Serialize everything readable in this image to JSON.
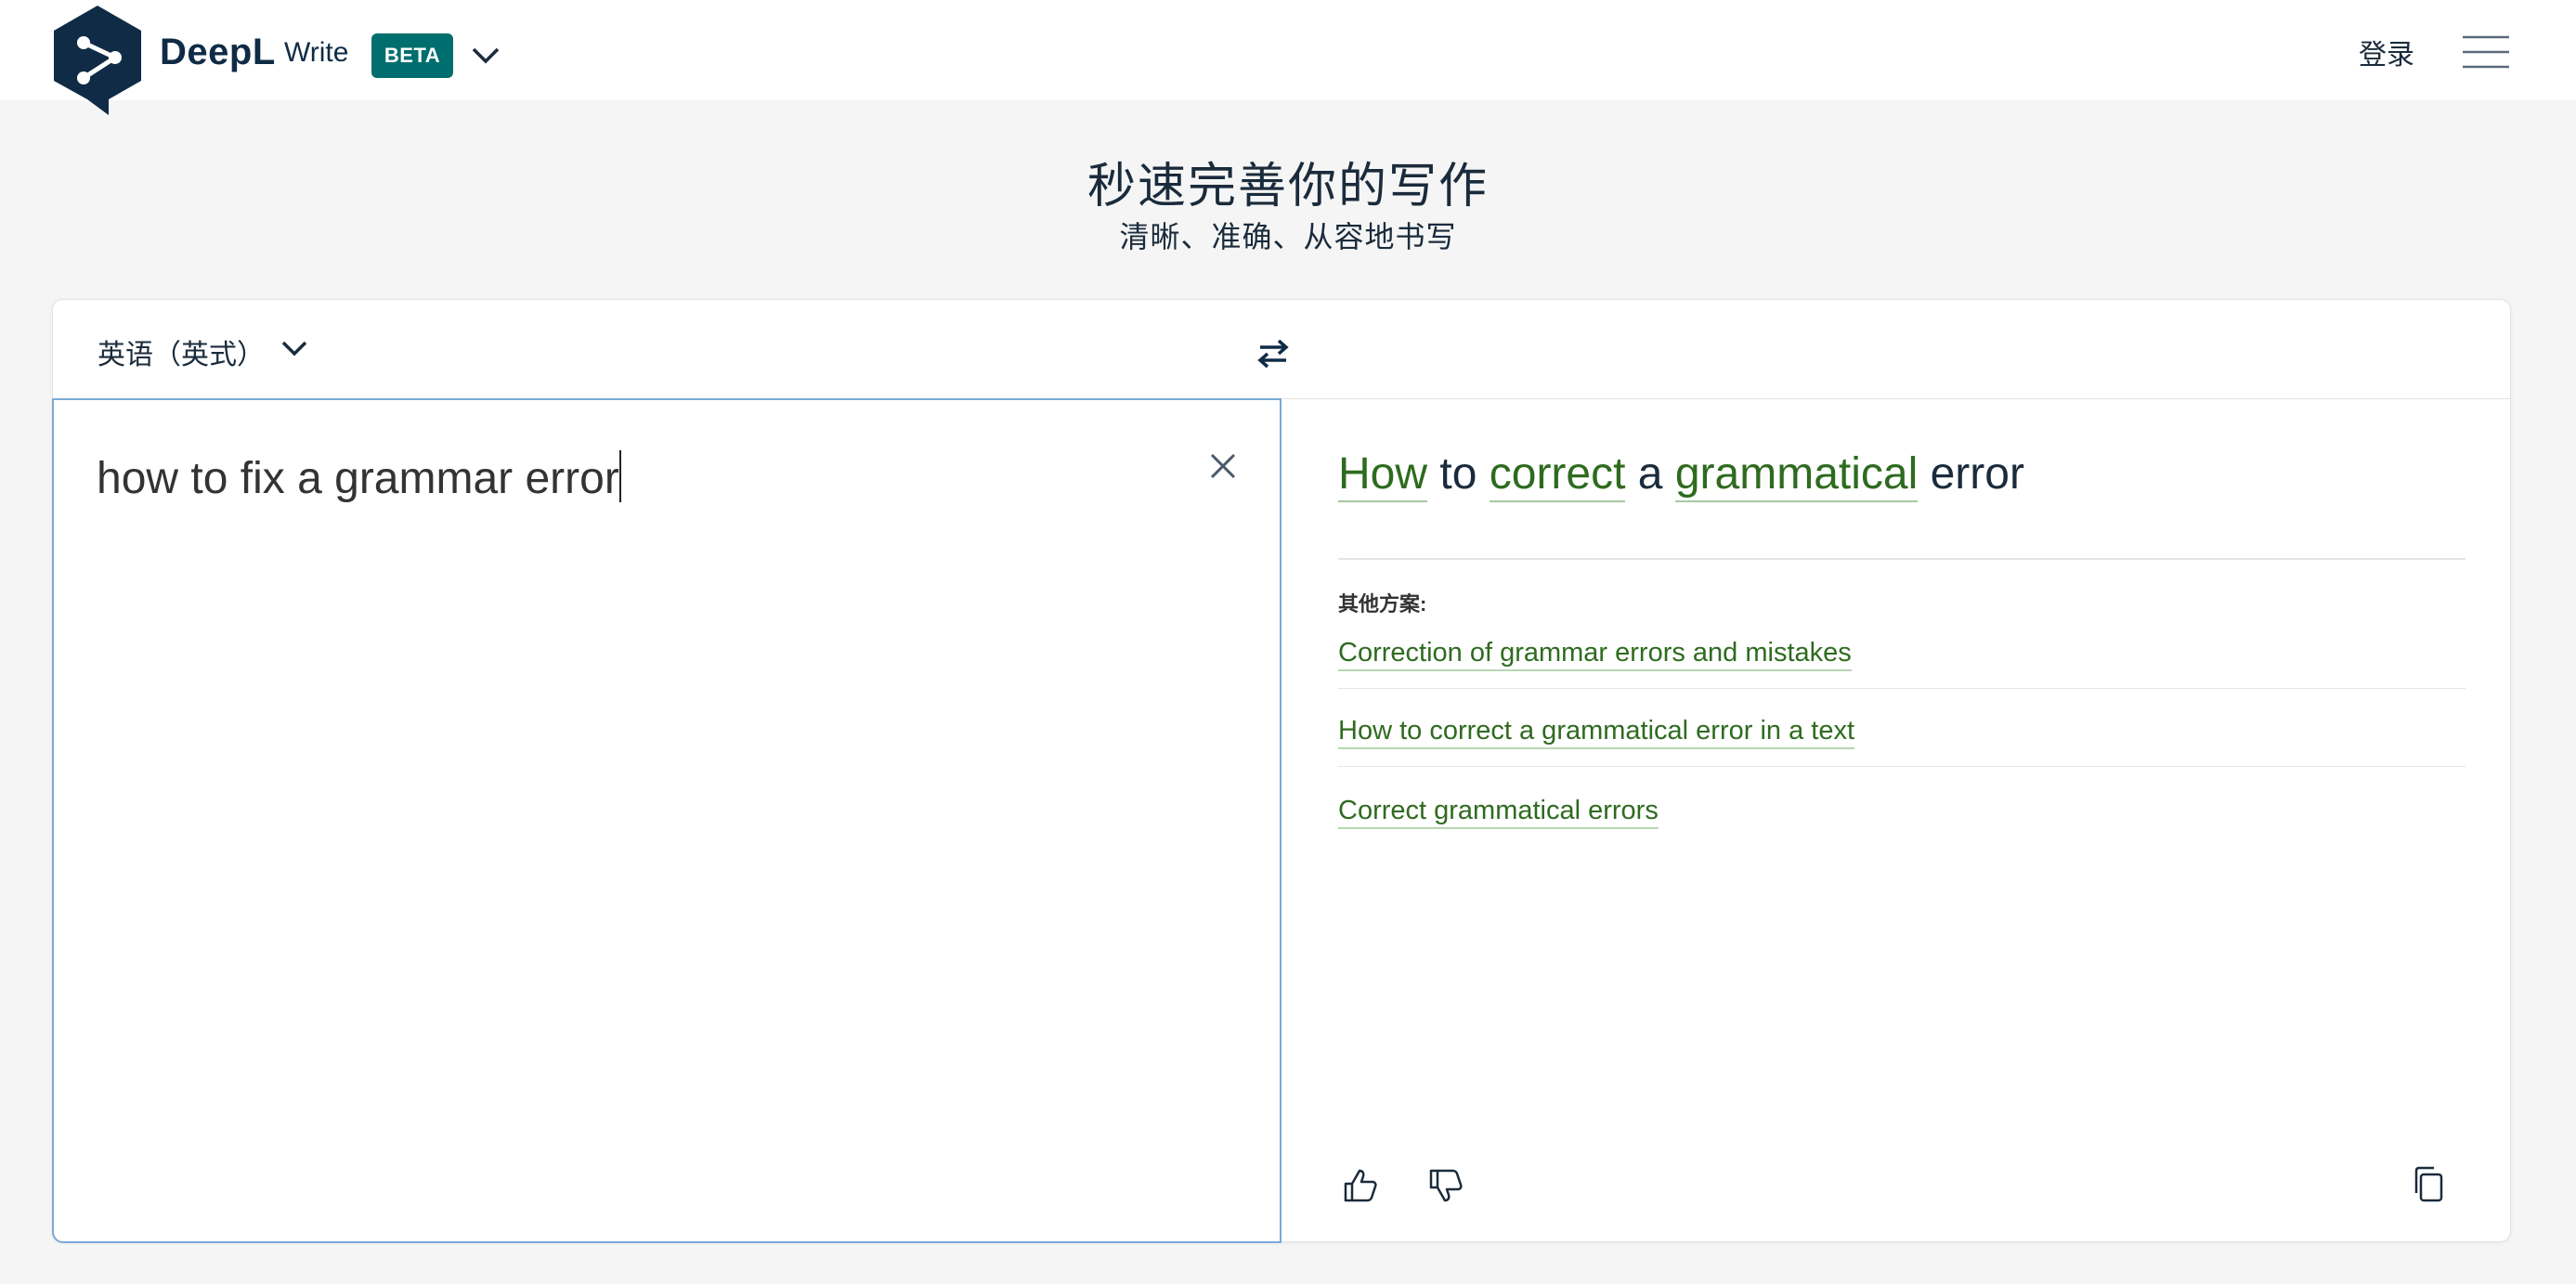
{
  "header": {
    "brand": "DeepL",
    "product": "Write",
    "badge": "BETA",
    "login_label": "登录"
  },
  "hero": {
    "title": "秒速完善你的写作",
    "subtitle": "清晰、准确、从容地书写"
  },
  "editor": {
    "language": "英语（英式）",
    "input_text": "how to fix a grammar error"
  },
  "output": {
    "main_words": [
      "How",
      "to",
      "correct",
      "a",
      "grammatical",
      "error"
    ],
    "alternatives_label": "其他方案:",
    "alternatives": [
      "Correction of grammar errors and mistakes",
      "How to correct a grammatical error in a text",
      "Correct grammatical errors"
    ]
  },
  "colors": {
    "brand_dark": "#0f2b46",
    "beta_badge": "#006e6e",
    "changed_word": "#2e6b1f",
    "input_focus_border": "#7ba9d6"
  }
}
